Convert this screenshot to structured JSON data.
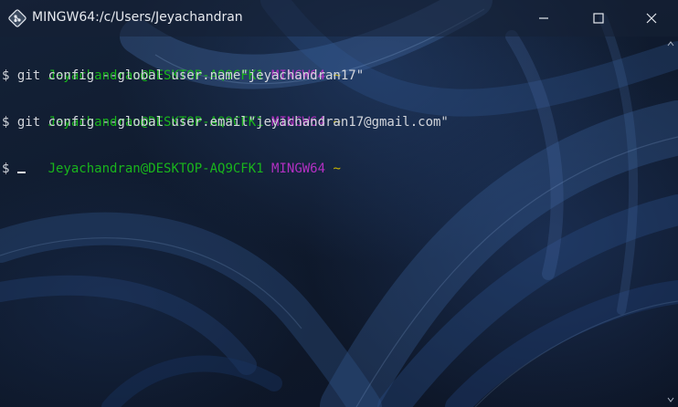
{
  "window": {
    "title": "MINGW64:/c/Users/Jeyachandran",
    "icon": "git-bash-icon",
    "controls": [
      "minimize",
      "maximize",
      "close"
    ]
  },
  "terminal": {
    "blocks": [
      {
        "prompt_user": "Jeyachandran@DESKTOP-AQ9CFK1",
        "prompt_shell": "MINGW64",
        "prompt_path": "~",
        "command": "$ git config --global user.name\"jeyachandran17\""
      },
      {
        "prompt_user": "Jeyachandran@DESKTOP-AQ9CFK1",
        "prompt_shell": "MINGW64",
        "prompt_path": "~",
        "command": "$ git config --global user.email\"jeyachandran17@gmail.com\""
      },
      {
        "prompt_user": "Jeyachandran@DESKTOP-AQ9CFK1",
        "prompt_shell": "MINGW64",
        "prompt_path": "~",
        "command": "$ "
      }
    ]
  },
  "colors": {
    "user": "#19b51c",
    "shell": "#b230c2",
    "path": "#c7b300",
    "text": "#d3d6dc",
    "background": "#0f1829"
  }
}
